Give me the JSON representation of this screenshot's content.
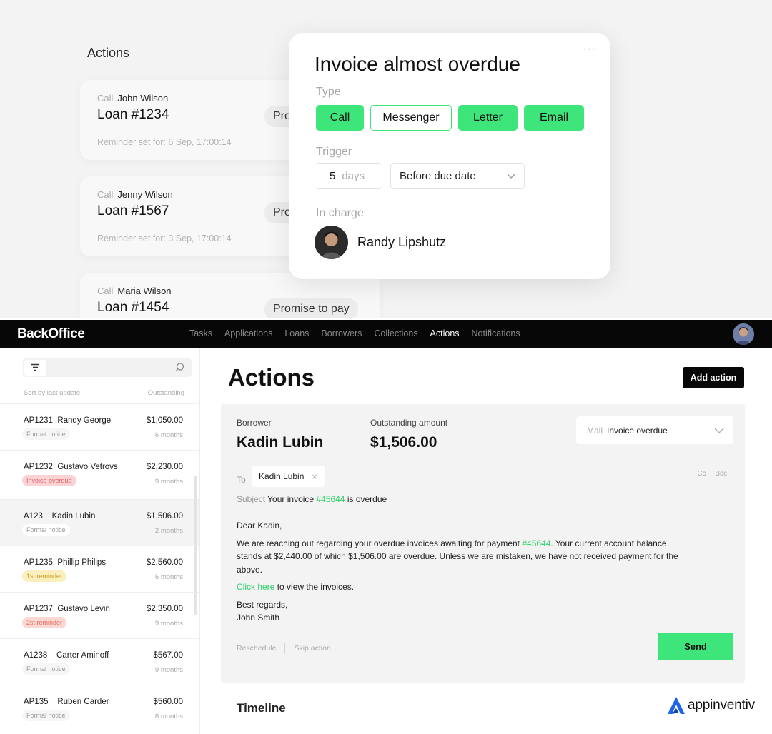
{
  "top_panel": {
    "title": "Actions",
    "cards": [
      {
        "kind": "Call",
        "name": "John Wilson",
        "loan": "Loan #1234",
        "status": "Pro",
        "reminder": "Reminder set for: 6 Sep, 17:00:14"
      },
      {
        "kind": "Call",
        "name": "Jenny Wilson",
        "loan": "Loan #1567",
        "status": "Pro",
        "reminder": "Reminder set for: 3 Sep, 17:00:14"
      },
      {
        "kind": "Call",
        "name": "Maria Wilson",
        "loan": "Loan #1454",
        "status": "Promise to pay",
        "reminder": ""
      }
    ],
    "modal": {
      "menu": "···",
      "title": "Invoice almost overdue",
      "type_label": "Type",
      "types": [
        {
          "label": "Call",
          "selected": true
        },
        {
          "label": "Messenger",
          "selected": false
        },
        {
          "label": "Letter",
          "selected": true
        },
        {
          "label": "Email",
          "selected": true
        }
      ],
      "trigger_label": "Trigger",
      "trigger_value": "5",
      "trigger_unit": "days",
      "trigger_option": "Before due date",
      "in_charge_label": "In charge",
      "in_charge_name": "Randy Lipshutz"
    }
  },
  "app": {
    "brand": "BackOffice",
    "nav": [
      {
        "label": "Tasks",
        "active": false
      },
      {
        "label": "Applications",
        "active": false
      },
      {
        "label": "Loans",
        "active": false
      },
      {
        "label": "Borrowers",
        "active": false
      },
      {
        "label": "Collections",
        "active": false
      },
      {
        "label": "Actions",
        "active": true
      },
      {
        "label": "Notifications",
        "active": false
      }
    ],
    "sidebar": {
      "sort_label": "Sort by last update",
      "outstanding_label": "Outstanding",
      "rows": [
        {
          "id": "AP1231",
          "name": "Randy George",
          "amount": "$1,050.00",
          "months": "6 months",
          "tag": "Formal notice",
          "tag_kind": "formal"
        },
        {
          "id": "AP1232",
          "name": "Gustavo Vetrovs",
          "amount": "$2,230.00",
          "months": "9 months",
          "tag": "Invoice overdue",
          "tag_kind": "overdue"
        },
        {
          "id": "A123",
          "name": "Kadin Lubin",
          "amount": "$1,506.00",
          "months": "2 months",
          "tag": "Formal notice",
          "tag_kind": "formal"
        },
        {
          "id": "AP1235",
          "name": "Phillip Philips",
          "amount": "$2,560.00",
          "months": "6 months",
          "tag": "1st reminder",
          "tag_kind": "first"
        },
        {
          "id": "AP1237",
          "name": "Gustavo Levin",
          "amount": "$2,350.00",
          "months": "9 months",
          "tag": "2st reminder",
          "tag_kind": "second"
        },
        {
          "id": "A1238",
          "name": "Carter Aminoff",
          "amount": "$567.00",
          "months": "9 months",
          "tag": "Formal notice",
          "tag_kind": "formal"
        },
        {
          "id": "AP135",
          "name": "Ruben Carder",
          "amount": "$560.00",
          "months": "6 months",
          "tag": "Formal notice",
          "tag_kind": "formal"
        }
      ],
      "selected_index": 2
    },
    "main": {
      "title": "Actions",
      "add_action": "Add action",
      "borrower_label": "Borrower",
      "borrower_name": "Kadin Lubin",
      "outstanding_label": "Outstanding amount",
      "outstanding_amount": "$1,506.00",
      "mail_prefix": "Mail",
      "mail_template": "Invoice overdue",
      "to_label": "To",
      "to_recipient": "Kadin Lubin",
      "chip_close": "×",
      "cc_bcc": "Cc Bcc",
      "subject_label": "Subject",
      "subject_before": "Your invoice",
      "invoice_ref": "#45644",
      "subject_after": "is overdue",
      "greeting": "Dear Kadin,",
      "paragraph_before": "We are reaching out regarding your overdue invoices awaiting for payment",
      "paragraph_after": ". Your current account balance stands at $2,440.00 of which $1,506.00 are overdue. Unless we are mistaken, we have not received payment for the above.",
      "click_here": "Click here",
      "click_after": "to view the invoices.",
      "regards": "Best regards,",
      "signature": "John Smith",
      "reschedule": "Reschedule",
      "skip_action": "Skip action",
      "send": "Send",
      "timeline": "Timeline"
    },
    "watermark": "appinventiv",
    "colors": {
      "accent_green": "#3ee57a",
      "link_green": "#2ed267",
      "navbar": "#070707"
    }
  }
}
